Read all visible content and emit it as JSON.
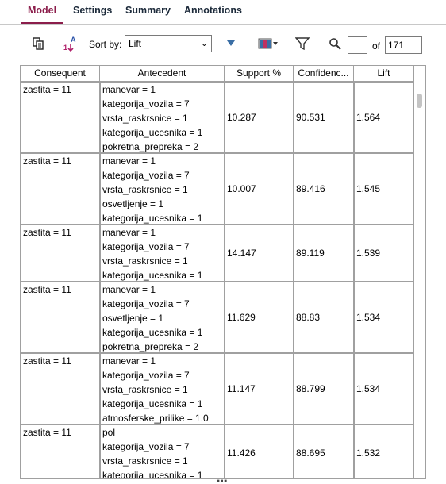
{
  "tabs": [
    {
      "label": "Model",
      "active": true
    },
    {
      "label": "Settings",
      "active": false
    },
    {
      "label": "Summary",
      "active": false
    },
    {
      "label": "Annotations",
      "active": false
    }
  ],
  "toolbar": {
    "sort_label": "Sort by:",
    "sort_value": "Lift",
    "of_label": "of",
    "total": "171",
    "current": ""
  },
  "columns": [
    "Consequent",
    "Antecedent",
    "Support %",
    "Confidenc...",
    "Lift"
  ],
  "rows": [
    {
      "consequent": "zastita = 11",
      "antecedent": [
        "manevar = 1",
        "kategorija_vozila = 7",
        "vrsta_raskrsnice = 1",
        "kategorija_ucesnika = 1",
        "pokretna_prepreka = 2"
      ],
      "support": "10.287",
      "confidence": "90.531",
      "lift": "1.564"
    },
    {
      "consequent": "zastita = 11",
      "antecedent": [
        "manevar = 1",
        "kategorija_vozila = 7",
        "vrsta_raskrsnice = 1",
        "osvetljenje = 1",
        "kategorija_ucesnika = 1"
      ],
      "support": "10.007",
      "confidence": "89.416",
      "lift": "1.545"
    },
    {
      "consequent": "zastita = 11",
      "antecedent": [
        "manevar = 1",
        "kategorija_vozila = 7",
        "vrsta_raskrsnice = 1",
        "kategorija_ucesnika = 1"
      ],
      "support": "14.147",
      "confidence": "89.119",
      "lift": "1.539"
    },
    {
      "consequent": "zastita = 11",
      "antecedent": [
        "manevar = 1",
        "kategorija_vozila = 7",
        "osvetljenje = 1",
        "kategorija_ucesnika = 1",
        "pokretna_prepreka = 2"
      ],
      "support": "11.629",
      "confidence": "88.83",
      "lift": "1.534"
    },
    {
      "consequent": "zastita = 11",
      "antecedent": [
        "manevar = 1",
        "kategorija_vozila = 7",
        "vrsta_raskrsnice = 1",
        "kategorija_ucesnika = 1",
        "atmosferske_prilike = 1.0"
      ],
      "support": "11.147",
      "confidence": "88.799",
      "lift": "1.534"
    },
    {
      "consequent": "zastita = 11",
      "antecedent": [
        "pol",
        "kategorija_vozila = 7",
        "vrsta_raskrsnice = 1",
        "kategorija_ucesnika = 1"
      ],
      "support": "11.426",
      "confidence": "88.695",
      "lift": "1.532"
    }
  ]
}
